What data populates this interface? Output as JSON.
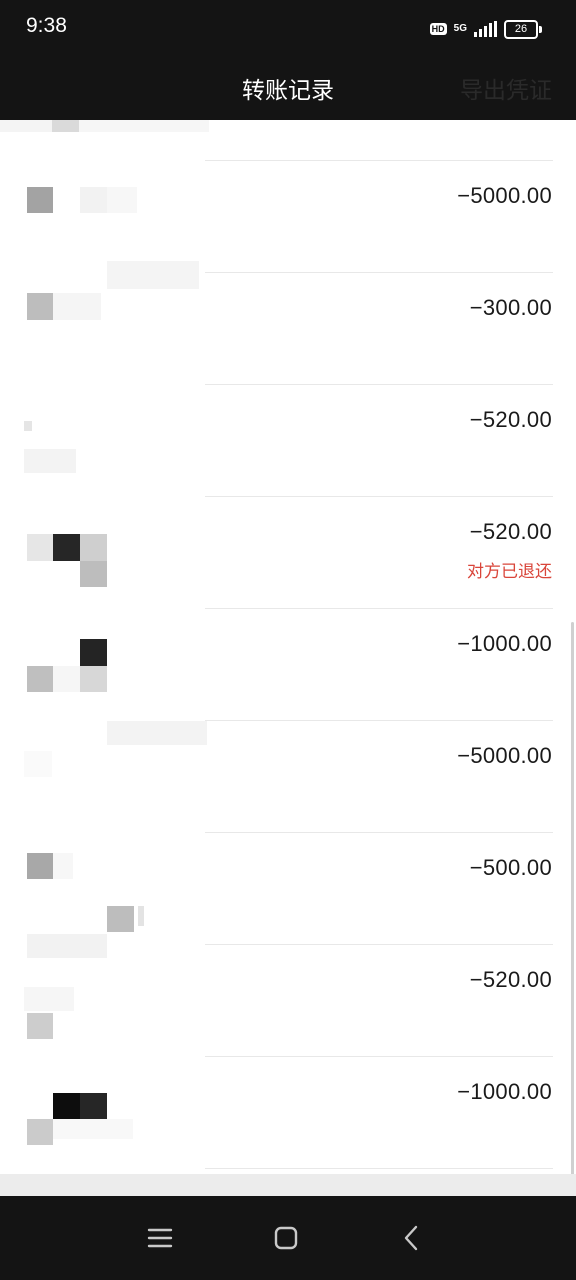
{
  "status_bar": {
    "time": "9:38",
    "hd_badge": "HD",
    "network": "5G",
    "battery_level": "26"
  },
  "nav": {
    "title": "转账记录",
    "action": "导出凭证"
  },
  "records": [
    {
      "amount": "−5000.00",
      "status": ""
    },
    {
      "amount": "−300.00",
      "status": ""
    },
    {
      "amount": "−520.00",
      "status": ""
    },
    {
      "amount": "−520.00",
      "status": "对方已退还"
    },
    {
      "amount": "−1000.00",
      "status": ""
    },
    {
      "amount": "−5000.00",
      "status": ""
    },
    {
      "amount": "−500.00",
      "status": ""
    },
    {
      "amount": "−520.00",
      "status": ""
    },
    {
      "amount": "−1000.00",
      "status": ""
    }
  ],
  "colors": {
    "bar_background": "#141414",
    "amount_text": "#1a1a1a",
    "refund_status": "#d9453a",
    "divider": "#e8e8e8"
  },
  "icons": {
    "system_nav": [
      "menu-icon",
      "home-icon",
      "back-icon"
    ]
  }
}
